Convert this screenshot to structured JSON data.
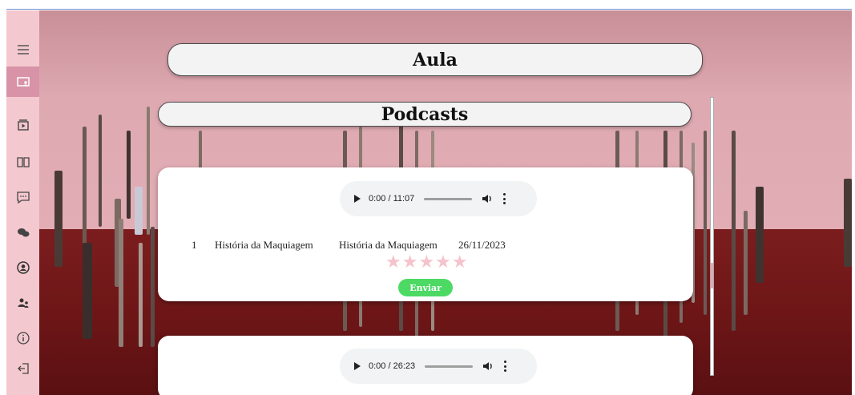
{
  "titles": {
    "aula": "Aula",
    "podcasts": "Podcasts"
  },
  "sidebar": {
    "items": [
      {
        "icon": "menu-icon",
        "active": false
      },
      {
        "icon": "class-screen-icon",
        "active": true
      },
      {
        "icon": "podcast-play-icon",
        "active": false
      },
      {
        "icon": "book-icon",
        "active": false
      },
      {
        "icon": "chat-icon",
        "active": false
      },
      {
        "icon": "community-icon",
        "active": false
      },
      {
        "icon": "profile-icon",
        "active": false
      },
      {
        "icon": "users-icon",
        "active": false
      },
      {
        "icon": "info-icon",
        "active": false
      },
      {
        "icon": "logout-icon",
        "active": false
      }
    ]
  },
  "podcasts": [
    {
      "player_time": "0:00 / 11:07",
      "number": "1",
      "title": "História da Maquiagem",
      "description": "História da Maquiagem",
      "date": "26/11/2023",
      "rating_stars": "★★★★★",
      "rating_value": 0,
      "submit_label": "Enviar"
    },
    {
      "player_time": "0:00 / 26:23"
    }
  ],
  "colors": {
    "sidebar_bg": "#f4c8cf",
    "sidebar_active": "#d893a8",
    "star_empty": "#f5c3cc",
    "submit_button": "#4cd964",
    "wall": "#e2adb5",
    "floor": "#6e1617"
  }
}
